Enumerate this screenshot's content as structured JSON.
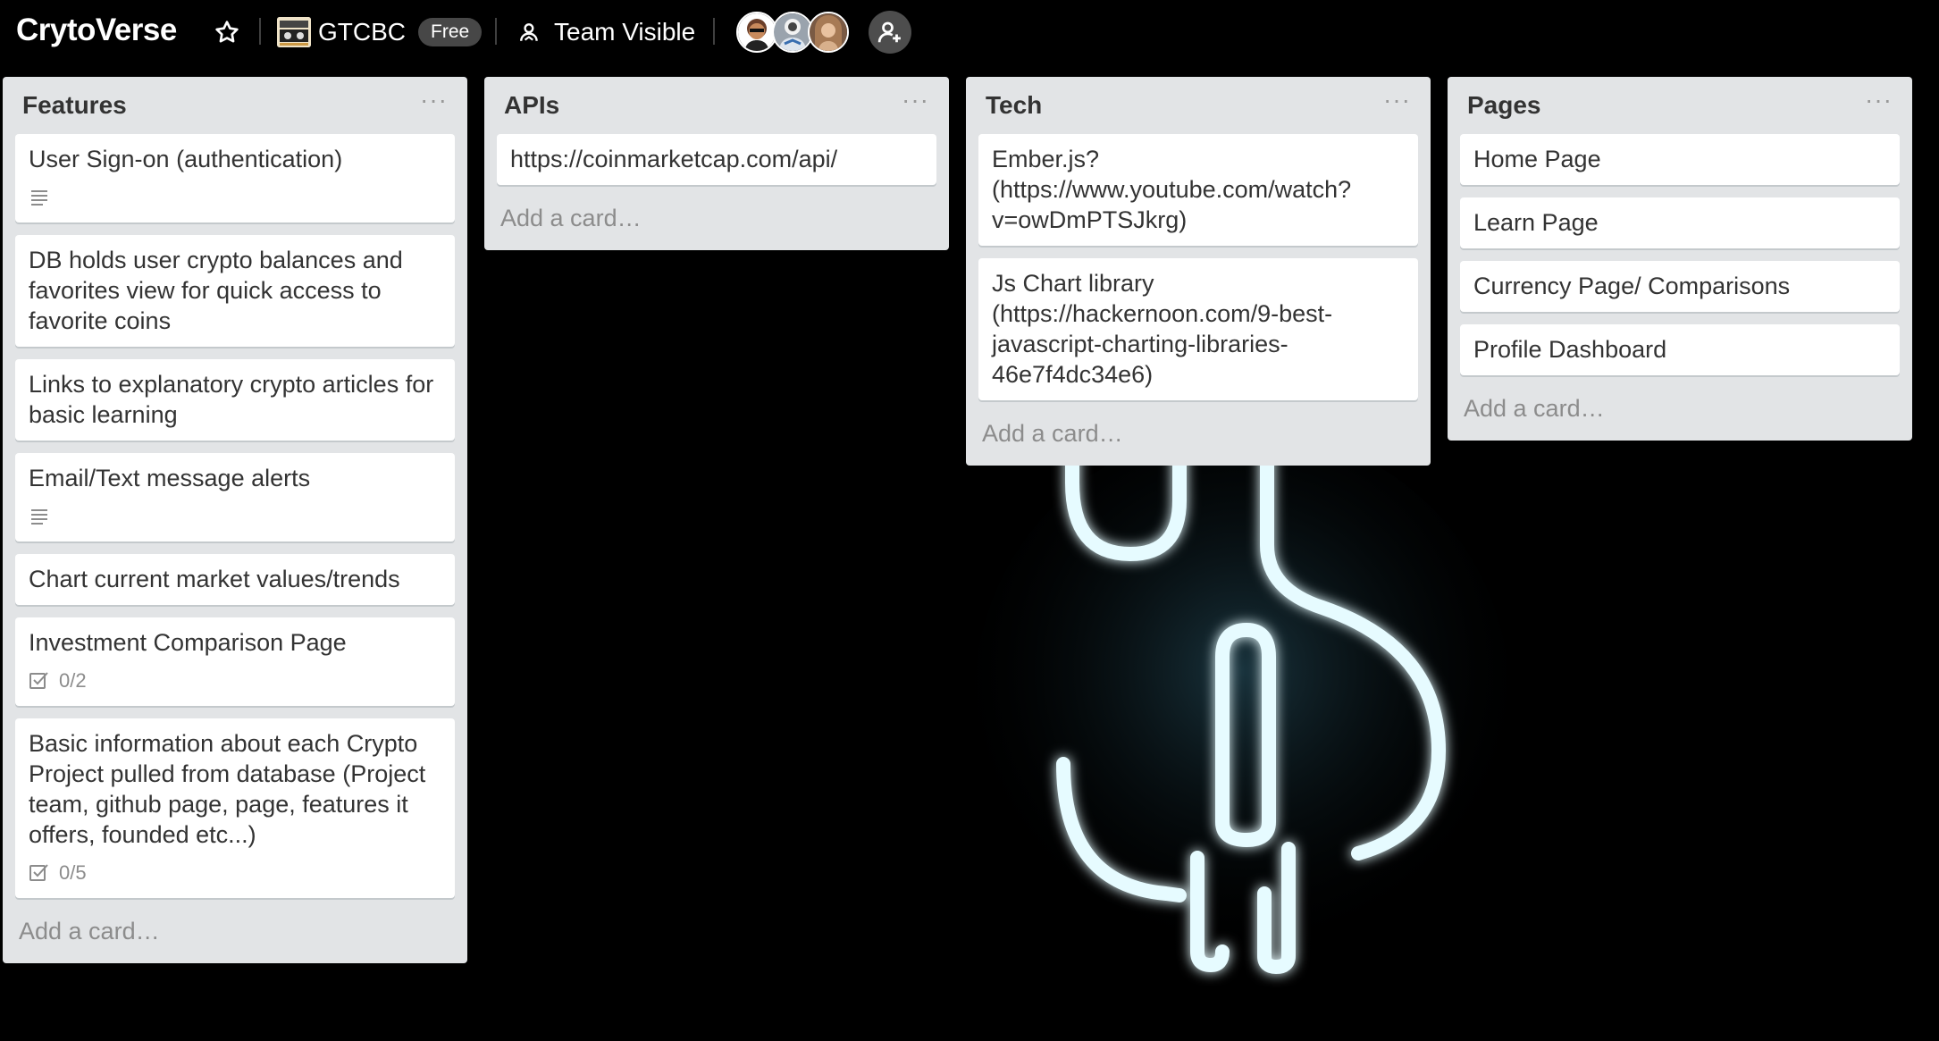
{
  "header": {
    "board_title": "CrytoVerse",
    "team_name": "GTCBC",
    "plan_badge": "Free",
    "visibility_label": "Team Visible",
    "star_icon": "star-outline-icon",
    "visibility_icon": "people-icon",
    "add_member_icon": "add-member-icon",
    "members": [
      {
        "name": "member-1",
        "color": "#f3c9a8"
      },
      {
        "name": "member-2",
        "color": "#9aa3ad"
      },
      {
        "name": "member-3",
        "color": "#c9a27c"
      }
    ]
  },
  "colors": {
    "list_bg": "#e2e4e6",
    "card_bg": "#ffffff",
    "page_bg": "#000000",
    "neon": "#dff7ff"
  },
  "lists": [
    {
      "title": "Features",
      "menu": "···",
      "cards": [
        {
          "text": "User Sign-on (authentication)",
          "badge": "description-icon"
        },
        {
          "text": "DB holds user crypto balances and favorites view for quick access to favorite coins"
        },
        {
          "text": "Links to explanatory crypto articles for basic learning"
        },
        {
          "text": "Email/Text message alerts",
          "badge": "description-icon"
        },
        {
          "text": "Chart current market values/trends"
        },
        {
          "text": "Investment Comparison Page",
          "checklist": "0/2"
        },
        {
          "text": "Basic information about each Crypto Project pulled from database (Project team, github page, page, features it offers, founded etc...)",
          "checklist": "0/5"
        }
      ],
      "add_card": "Add a card…"
    },
    {
      "title": "APIs",
      "menu": "···",
      "cards": [
        {
          "text": "https://coinmarketcap.com/api/"
        }
      ],
      "add_card": "Add a card…"
    },
    {
      "title": "Tech",
      "menu": "···",
      "cards": [
        {
          "text": "Ember.js? (https://www.youtube.com/watch?v=owDmPTSJkrg)"
        },
        {
          "text": "Js Chart library (https://hackernoon.com/9-best-javascript-charting-libraries-46e7f4dc34e6)"
        }
      ],
      "add_card": "Add a card…"
    },
    {
      "title": "Pages",
      "menu": "···",
      "cards": [
        {
          "text": "Home Page"
        },
        {
          "text": "Learn Page"
        },
        {
          "text": "Currency Page/ Comparisons"
        },
        {
          "text": "Profile Dashboard"
        }
      ],
      "add_card": "Add a card…"
    }
  ]
}
